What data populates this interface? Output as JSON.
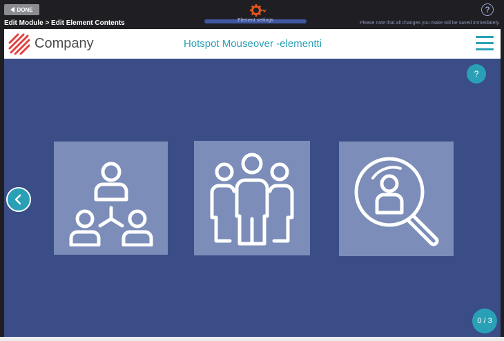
{
  "editor": {
    "done_label": "DONE",
    "breadcrumb": "Edit Module > Edit Element Contents",
    "notice": "Please note that all changes you make will be saved immediately.",
    "help_label": "?",
    "gear_bar_label": "Element settings"
  },
  "header": {
    "company": "Company",
    "title": "Hotspot Mouseover -elementti"
  },
  "content": {
    "help_label": "?",
    "counter": "0 / 3",
    "tiles": [
      {
        "icon": "organization-icon"
      },
      {
        "icon": "group-icon"
      },
      {
        "icon": "search-user-icon"
      }
    ]
  },
  "colors": {
    "accent": "#2aa0b6",
    "background": "#3a4d86",
    "tile": "#7b8db8",
    "logo": "#e2403f"
  }
}
